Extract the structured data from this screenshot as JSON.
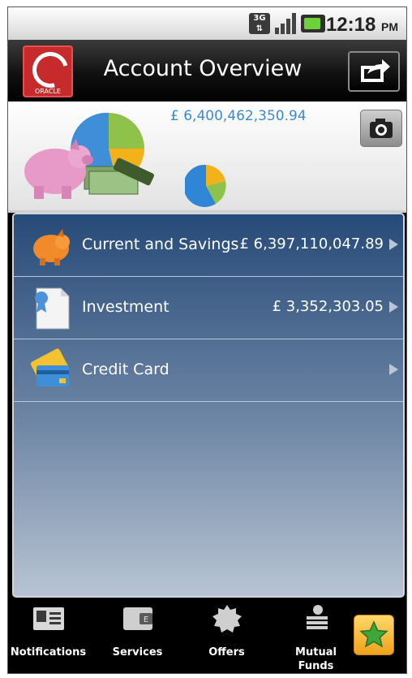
{
  "status_bar": {
    "network": "3G",
    "time": "12:18",
    "ampm": "PM"
  },
  "header": {
    "title": "Account Overview",
    "logo_text": "ORACLE",
    "total_balance": "£ 6,400,462,350.94"
  },
  "accounts": [
    {
      "label": "Current and Savings",
      "amount": "£ 6,397,110,047.89",
      "icon": "piggy-bank-icon"
    },
    {
      "label": "Investment",
      "amount": "£ 3,352,303.05",
      "icon": "certificate-icon"
    },
    {
      "label": "Credit Card",
      "amount": "",
      "icon": "credit-card-icon"
    }
  ],
  "bottom_nav": [
    {
      "label": "Notifications",
      "icon": "id-card-icon"
    },
    {
      "label": "Services",
      "icon": "wallet-icon"
    },
    {
      "label": "Offers",
      "icon": "badge-icon"
    },
    {
      "label": "Mutual Funds",
      "icon": "money-bag-icon"
    }
  ],
  "colors": {
    "accent_blue": "#3b89d0",
    "list_top": "#264a78",
    "list_bottom": "#b8c4d3",
    "logo_red": "#c62a2a",
    "favorite_gold": "#f0a21a"
  }
}
